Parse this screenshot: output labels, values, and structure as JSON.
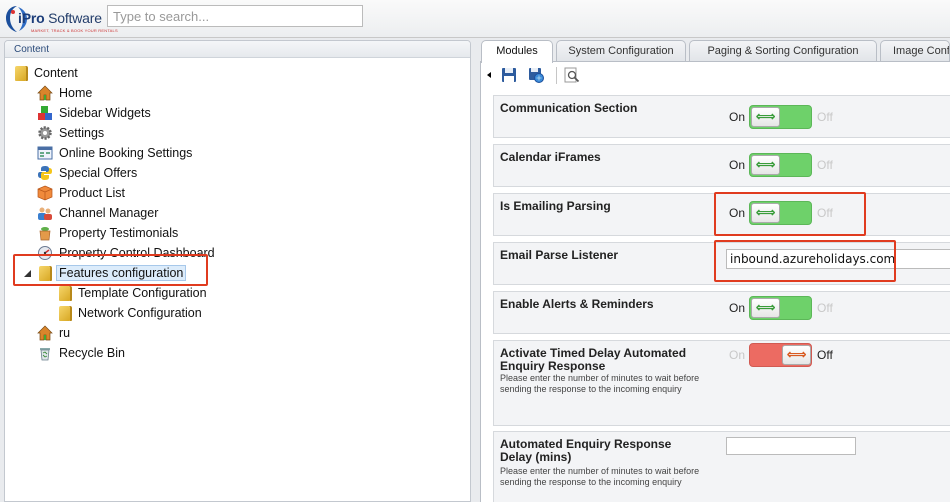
{
  "app": {
    "logo_text_bold": "iPro",
    "logo_text_normal": " Software",
    "logo_tagline": "MARKET, TRACK & BOOK YOUR RENTALS"
  },
  "search": {
    "placeholder": "Type to search...",
    "value": ""
  },
  "left_panel": {
    "title": "Content"
  },
  "tree": [
    {
      "label": "Content",
      "icon": "folder-icon",
      "expander": "none"
    },
    {
      "label": "Home",
      "icon": "home-icon",
      "expander": "closed"
    },
    {
      "label": "Sidebar Widgets",
      "icon": "widgets-icon",
      "expander": "closed"
    },
    {
      "label": "Settings",
      "icon": "gear-icon",
      "expander": "closed"
    },
    {
      "label": "Online Booking Settings",
      "icon": "booking-icon",
      "expander": "closed"
    },
    {
      "label": "Special Offers",
      "icon": "python-icon",
      "expander": "closed"
    },
    {
      "label": "Product List",
      "icon": "package-icon",
      "expander": "closed"
    },
    {
      "label": "Channel Manager",
      "icon": "users-icon",
      "expander": "closed"
    },
    {
      "label": "Property Testimonials",
      "icon": "pot-icon",
      "expander": "closed"
    },
    {
      "label": "Property Control Dashboard",
      "icon": "dashboard-icon",
      "expander": "none"
    },
    {
      "label": "Features configuration",
      "icon": "folder-icon",
      "expander": "open",
      "selected": true
    },
    {
      "label": "Template Configuration",
      "icon": "folder-icon",
      "expander": "none"
    },
    {
      "label": "Network Configuration",
      "icon": "folder-icon",
      "expander": "none"
    },
    {
      "label": "ru",
      "icon": "home-icon",
      "expander": "closed"
    },
    {
      "label": "Recycle Bin",
      "icon": "recycle-bin-icon",
      "expander": "closed"
    }
  ],
  "tabs": [
    {
      "label": "Modules",
      "active": true
    },
    {
      "label": "System Configuration"
    },
    {
      "label": "Paging & Sorting Configuration"
    },
    {
      "label": "Image Conf"
    }
  ],
  "toolbar": {
    "icons": [
      "collapse-arrow-icon",
      "save-icon",
      "save-publish-icon",
      "preview-icon"
    ]
  },
  "properties": [
    {
      "label": "Communication Section",
      "type": "toggle",
      "state": "on",
      "on": "On",
      "off": "Off"
    },
    {
      "label": "Calendar iFrames",
      "type": "toggle",
      "state": "on",
      "on": "On",
      "off": "Off"
    },
    {
      "label": "Is Emailing Parsing",
      "type": "toggle",
      "state": "on",
      "on": "On",
      "off": "Off"
    },
    {
      "label": "Email Parse Listener",
      "type": "text",
      "value": "inbound.azureholidays.com"
    },
    {
      "label": "Enable Alerts & Reminders",
      "type": "toggle",
      "state": "on",
      "on": "On",
      "off": "Off"
    },
    {
      "label": "Activate Timed Delay Automated Enquiry Response",
      "help": "Please enter the number of minutes to wait before sending the response to the incoming enquiry",
      "type": "toggle",
      "state": "off",
      "on": "On",
      "off": "Off"
    },
    {
      "label": "Automated Enquiry Response Delay (mins)",
      "help": "Please enter the number of minutes to wait before sending the response to the incoming enquiry",
      "type": "text",
      "value": ""
    }
  ],
  "colors": {
    "toggle_on": "#6ed16a",
    "toggle_off": "#ec6b62",
    "highlight": "#e03b1f",
    "selected_bg": "#dcecfb"
  }
}
